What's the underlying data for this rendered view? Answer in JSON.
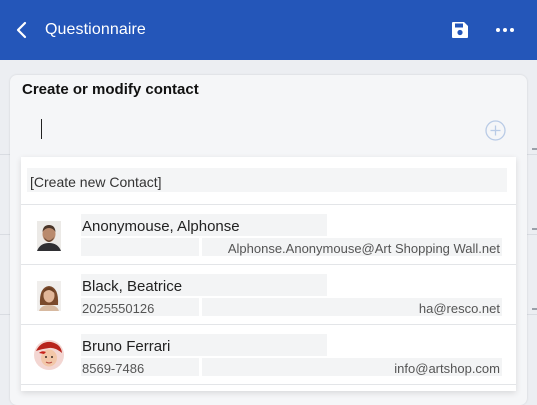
{
  "header": {
    "title": "Questionnaire",
    "back_icon": "chevron-left-icon",
    "save_icon": "floppy-disk-icon",
    "more_icon": "more-horizontal-icon",
    "color": "#2456b9"
  },
  "form": {
    "title": "Create or modify contact",
    "add_icon": "plus-circle-icon"
  },
  "dropdown": {
    "create_label": "[Create new Contact]",
    "contacts": [
      {
        "name": "Anonymouse, Alphonse",
        "phone": "",
        "email": "Alphonse.Anonymouse@Art Shopping Wall.net",
        "avatar": "male-photo-avatar"
      },
      {
        "name": "Black, Beatrice",
        "phone": "2025550126",
        "email": "ha@resco.net",
        "avatar": "female-photo-avatar"
      },
      {
        "name": "Bruno Ferrari",
        "phone": "8569-7486",
        "email": "info@artshop.com",
        "avatar": "illustrated-avatar"
      }
    ]
  }
}
